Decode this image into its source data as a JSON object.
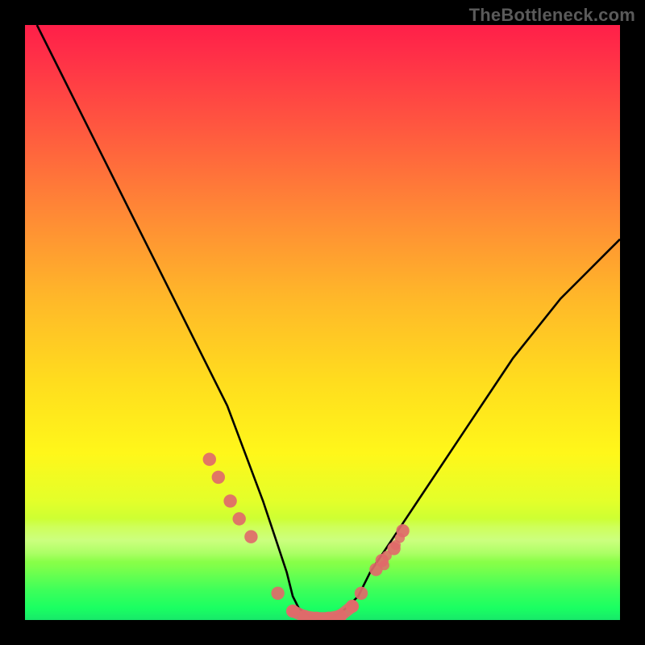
{
  "watermark": "TheBottleneck.com",
  "colors": {
    "background": "#000000",
    "curve": "#000000",
    "marker": "#e06a6a",
    "gradient_top": "#ff1f49",
    "gradient_bottom": "#17e86a"
  },
  "chart_data": {
    "type": "line",
    "title": "",
    "xlabel": "",
    "ylabel": "",
    "xlim": [
      0,
      100
    ],
    "ylim": [
      0,
      100
    ],
    "series": [
      {
        "name": "bottleneck-curve",
        "x": [
          2,
          6,
          10,
          14,
          18,
          22,
          26,
          30,
          34,
          37,
          40,
          42,
          44,
          45,
          46,
          48,
          50,
          52,
          54,
          56,
          58,
          62,
          66,
          70,
          74,
          78,
          82,
          86,
          90,
          94,
          98,
          100
        ],
        "y": [
          100,
          92,
          84,
          76,
          68,
          60,
          52,
          44,
          36,
          28,
          20,
          14,
          8,
          4,
          2,
          0.5,
          0,
          0.5,
          2,
          4,
          8,
          14,
          20,
          26,
          32,
          38,
          44,
          49,
          54,
          58,
          62,
          64
        ]
      }
    ],
    "markers": {
      "name": "measured-points",
      "x": [
        31,
        32.5,
        34.5,
        36,
        38,
        42.5,
        45,
        47,
        49,
        51,
        53,
        55,
        56.5,
        59,
        60,
        62,
        63.5
      ],
      "y": [
        27,
        24,
        20,
        17,
        14,
        4.5,
        1.5,
        0.6,
        0.3,
        0.3,
        0.7,
        2.3,
        4.5,
        8.5,
        10,
        12,
        15
      ]
    }
  }
}
